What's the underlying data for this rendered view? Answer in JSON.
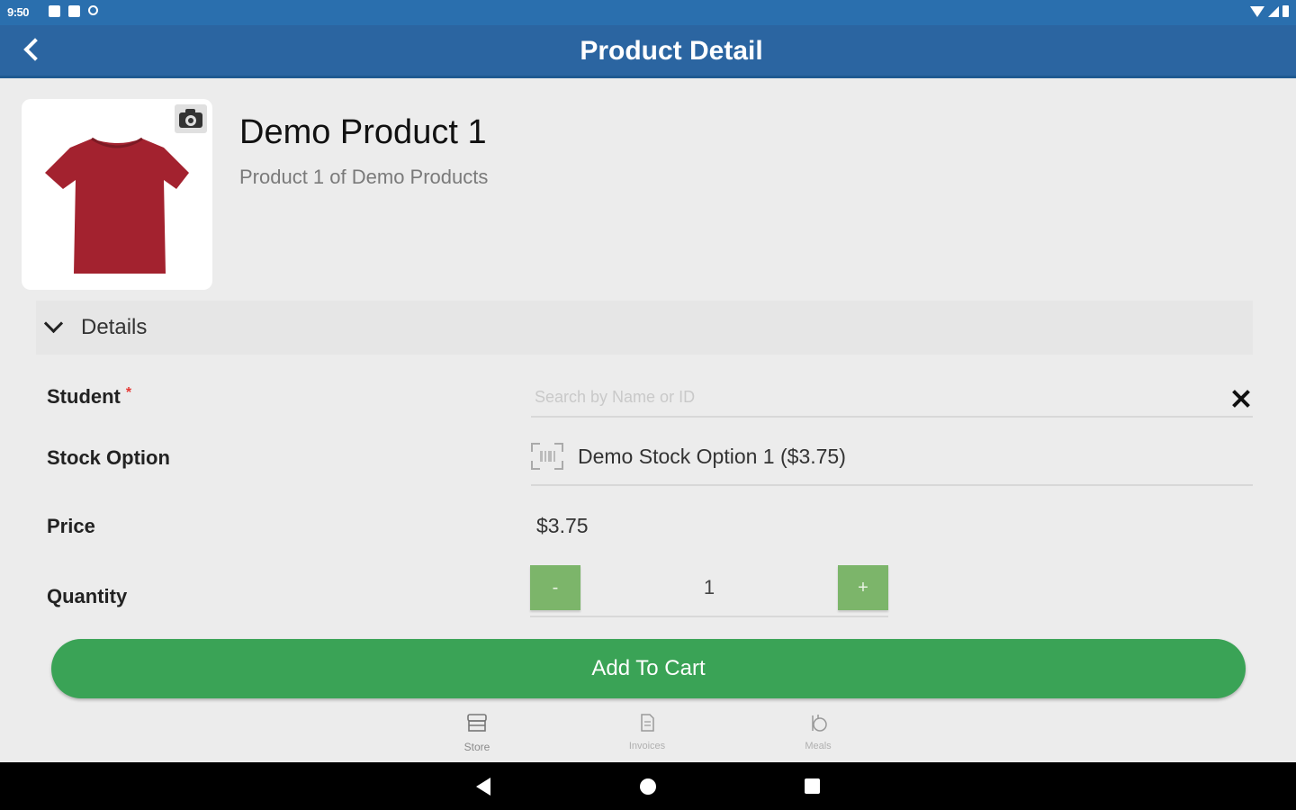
{
  "status_bar": {
    "time": "9:50"
  },
  "app_bar": {
    "title": "Product Detail"
  },
  "product": {
    "name": "Demo Product 1",
    "description": "Product 1 of Demo Products",
    "image_color": "#a3222f"
  },
  "details": {
    "section_label": "Details",
    "student_label": "Student",
    "required_marker": "*",
    "student_placeholder": "Search by Name or ID",
    "student_value": "",
    "stock_option_label": "Stock Option",
    "stock_option_value": "Demo Stock Option 1 ($3.75)",
    "price_label": "Price",
    "price_value": "$3.75",
    "quantity_label": "Quantity",
    "quantity_decrement": "-",
    "quantity_increment": "+",
    "quantity_value": "1"
  },
  "actions": {
    "add_to_cart": "Add To Cart"
  },
  "bottom_nav": {
    "items": [
      {
        "label": "Store",
        "icon": "store-icon"
      },
      {
        "label": "Invoices",
        "icon": "invoice-icon"
      },
      {
        "label": "Meals",
        "icon": "meals-icon"
      }
    ]
  },
  "colors": {
    "app_bar": "#2b65a1",
    "status_bar": "#2a6fae",
    "accent_green": "#3aa356",
    "stepper_green": "#7cb56a"
  }
}
